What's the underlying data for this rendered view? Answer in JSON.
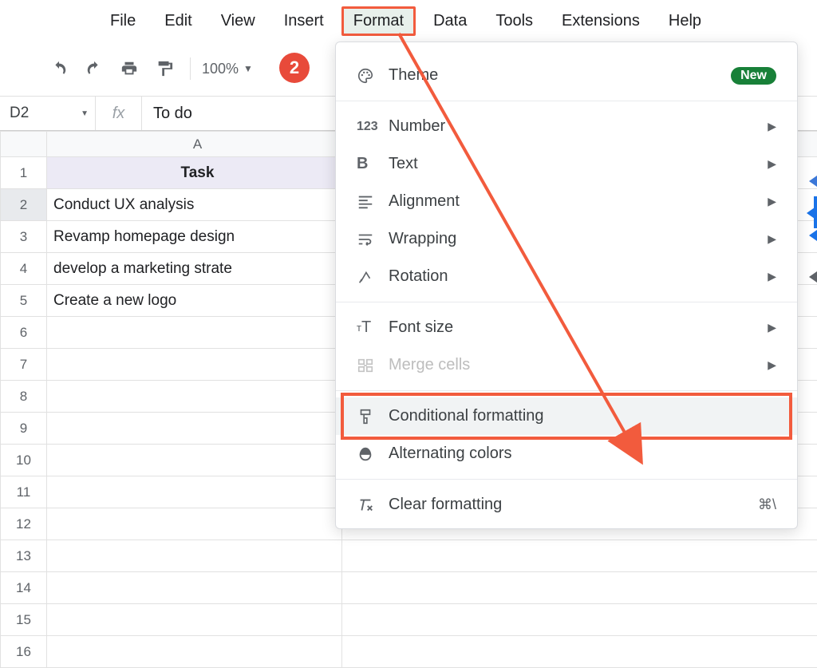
{
  "menubar": {
    "items": [
      "File",
      "Edit",
      "View",
      "Insert",
      "Format",
      "Data",
      "Tools",
      "Extensions",
      "Help"
    ],
    "active_index": 4
  },
  "toolbar": {
    "zoom": "100%"
  },
  "annotation": {
    "badge": "2"
  },
  "fxbar": {
    "namebox": "D2",
    "fx_symbol": "fx",
    "formula_value": "To do"
  },
  "grid": {
    "column_headers": [
      "A"
    ],
    "row_numbers": [
      "1",
      "2",
      "3",
      "4",
      "5",
      "6",
      "7",
      "8",
      "9",
      "10",
      "11",
      "12",
      "13",
      "14",
      "15",
      "16"
    ],
    "rows": [
      {
        "a": "Task",
        "header": true
      },
      {
        "a": "Conduct UX analysis"
      },
      {
        "a": "Revamp homepage design"
      },
      {
        "a": "develop a marketing strate"
      },
      {
        "a": "Create a new logo"
      },
      {
        "a": ""
      },
      {
        "a": ""
      },
      {
        "a": ""
      },
      {
        "a": ""
      },
      {
        "a": ""
      },
      {
        "a": ""
      },
      {
        "a": ""
      },
      {
        "a": ""
      },
      {
        "a": ""
      },
      {
        "a": ""
      },
      {
        "a": ""
      }
    ]
  },
  "dropdown": {
    "theme": {
      "label": "Theme",
      "badge": "New"
    },
    "number": {
      "label": "Number"
    },
    "text": {
      "label": "Text"
    },
    "alignment": {
      "label": "Alignment"
    },
    "wrapping": {
      "label": "Wrapping"
    },
    "rotation": {
      "label": "Rotation"
    },
    "fontsize": {
      "label": "Font size"
    },
    "merge": {
      "label": "Merge cells"
    },
    "conditional": {
      "label": "Conditional formatting"
    },
    "alternating": {
      "label": "Alternating colors"
    },
    "clear": {
      "label": "Clear formatting",
      "shortcut": "⌘\\"
    }
  }
}
